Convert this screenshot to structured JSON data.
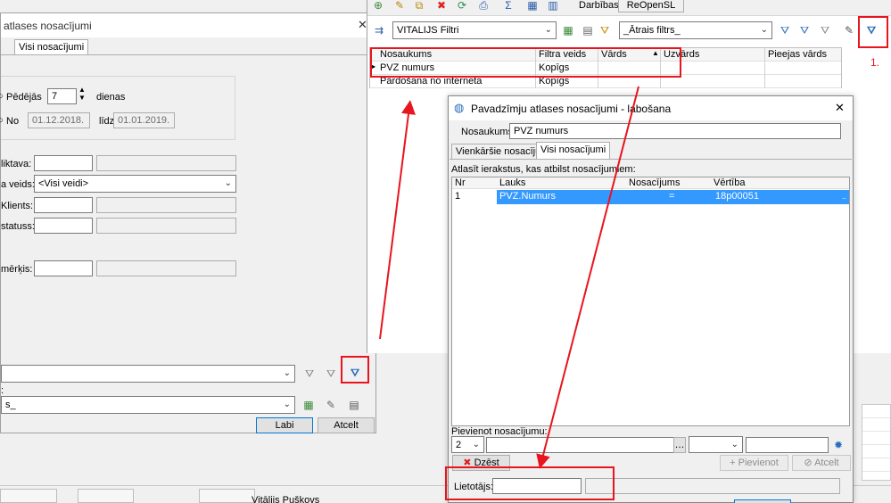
{
  "colors": {
    "accent": "#0078d7",
    "annotation": "#e8141e",
    "selection": "#3399ff"
  },
  "bg_dialog": {
    "title": "atlases nosacījumi",
    "tab_all": "Visi nosacījumi",
    "last_label": "Pēdējās",
    "last_value": "7",
    "days_label": "dienas",
    "from_label": "No",
    "from_value": "01.12.2018.",
    "to_label": "līdz",
    "to_value": "01.01.2019.",
    "label_1": "liktava:",
    "label_2": "a veids:",
    "type_value": "<Visi veidi>",
    "label_3": "Klients:",
    "label_4": "statuss:",
    "label_5": "mērķis:",
    "bottom_label": ":",
    "bottom_combo": "s_",
    "ok": "Labi",
    "cancel": "Atcelt"
  },
  "main": {
    "menu_actions": "Darbības",
    "reopen": "ReOpenSL",
    "filter_combo": "VITALIJS Filtri",
    "quick_filter": "_Ātrais filtrs_",
    "annotation_1": "1.",
    "grid": {
      "headers": [
        "Nosaukums",
        "Filtra veids",
        "Vārds",
        "Uzvārds",
        "Pieejas vārds"
      ],
      "rows": [
        [
          "PVZ numurs",
          "Kopīgs",
          "",
          "",
          ""
        ],
        [
          "Pārdošana no interneta",
          "Kopīgs",
          "",
          "",
          ""
        ]
      ]
    }
  },
  "edit_dialog": {
    "title": "Pavadzīmju atlases nosacījumi - labošana",
    "name_label": "Nosaukums:",
    "name_value": "PVZ numurs",
    "tab_simple": "Vienkāršie nosacījumi",
    "tab_all": "Visi nosacījumi",
    "select_label": "Atlasīt ierakstus, kas atbilst nosacījumiem:",
    "grid": {
      "headers": [
        "Nr",
        "Lauks",
        "Nosacījums",
        "Vērtība"
      ],
      "rows": [
        [
          "1",
          "PVZ.Numurs",
          "=",
          "18p00051"
        ]
      ]
    },
    "add_label": "Pievienot nosacījumu:",
    "add_combo": "2",
    "delete": "Dzēst",
    "add": "Pievienot",
    "cancel": "Atcelt",
    "user_label": "Lietotājs:"
  },
  "status_user": "Vitālijs Puškovs"
}
